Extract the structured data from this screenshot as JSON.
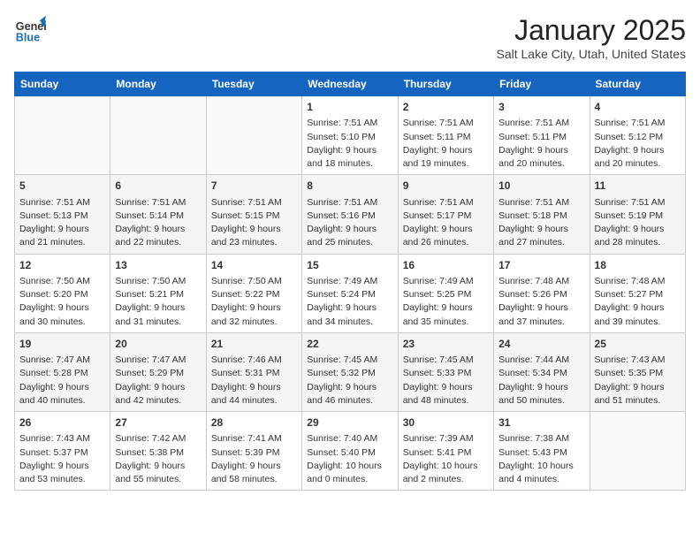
{
  "header": {
    "logo_line1": "General",
    "logo_line2": "Blue",
    "month": "January 2025",
    "location": "Salt Lake City, Utah, United States"
  },
  "days_of_week": [
    "Sunday",
    "Monday",
    "Tuesday",
    "Wednesday",
    "Thursday",
    "Friday",
    "Saturday"
  ],
  "weeks": [
    [
      {
        "day": "",
        "content": ""
      },
      {
        "day": "",
        "content": ""
      },
      {
        "day": "",
        "content": ""
      },
      {
        "day": "1",
        "content": "Sunrise: 7:51 AM\nSunset: 5:10 PM\nDaylight: 9 hours\nand 18 minutes."
      },
      {
        "day": "2",
        "content": "Sunrise: 7:51 AM\nSunset: 5:11 PM\nDaylight: 9 hours\nand 19 minutes."
      },
      {
        "day": "3",
        "content": "Sunrise: 7:51 AM\nSunset: 5:11 PM\nDaylight: 9 hours\nand 20 minutes."
      },
      {
        "day": "4",
        "content": "Sunrise: 7:51 AM\nSunset: 5:12 PM\nDaylight: 9 hours\nand 20 minutes."
      }
    ],
    [
      {
        "day": "5",
        "content": "Sunrise: 7:51 AM\nSunset: 5:13 PM\nDaylight: 9 hours\nand 21 minutes."
      },
      {
        "day": "6",
        "content": "Sunrise: 7:51 AM\nSunset: 5:14 PM\nDaylight: 9 hours\nand 22 minutes."
      },
      {
        "day": "7",
        "content": "Sunrise: 7:51 AM\nSunset: 5:15 PM\nDaylight: 9 hours\nand 23 minutes."
      },
      {
        "day": "8",
        "content": "Sunrise: 7:51 AM\nSunset: 5:16 PM\nDaylight: 9 hours\nand 25 minutes."
      },
      {
        "day": "9",
        "content": "Sunrise: 7:51 AM\nSunset: 5:17 PM\nDaylight: 9 hours\nand 26 minutes."
      },
      {
        "day": "10",
        "content": "Sunrise: 7:51 AM\nSunset: 5:18 PM\nDaylight: 9 hours\nand 27 minutes."
      },
      {
        "day": "11",
        "content": "Sunrise: 7:51 AM\nSunset: 5:19 PM\nDaylight: 9 hours\nand 28 minutes."
      }
    ],
    [
      {
        "day": "12",
        "content": "Sunrise: 7:50 AM\nSunset: 5:20 PM\nDaylight: 9 hours\nand 30 minutes."
      },
      {
        "day": "13",
        "content": "Sunrise: 7:50 AM\nSunset: 5:21 PM\nDaylight: 9 hours\nand 31 minutes."
      },
      {
        "day": "14",
        "content": "Sunrise: 7:50 AM\nSunset: 5:22 PM\nDaylight: 9 hours\nand 32 minutes."
      },
      {
        "day": "15",
        "content": "Sunrise: 7:49 AM\nSunset: 5:24 PM\nDaylight: 9 hours\nand 34 minutes."
      },
      {
        "day": "16",
        "content": "Sunrise: 7:49 AM\nSunset: 5:25 PM\nDaylight: 9 hours\nand 35 minutes."
      },
      {
        "day": "17",
        "content": "Sunrise: 7:48 AM\nSunset: 5:26 PM\nDaylight: 9 hours\nand 37 minutes."
      },
      {
        "day": "18",
        "content": "Sunrise: 7:48 AM\nSunset: 5:27 PM\nDaylight: 9 hours\nand 39 minutes."
      }
    ],
    [
      {
        "day": "19",
        "content": "Sunrise: 7:47 AM\nSunset: 5:28 PM\nDaylight: 9 hours\nand 40 minutes."
      },
      {
        "day": "20",
        "content": "Sunrise: 7:47 AM\nSunset: 5:29 PM\nDaylight: 9 hours\nand 42 minutes."
      },
      {
        "day": "21",
        "content": "Sunrise: 7:46 AM\nSunset: 5:31 PM\nDaylight: 9 hours\nand 44 minutes."
      },
      {
        "day": "22",
        "content": "Sunrise: 7:45 AM\nSunset: 5:32 PM\nDaylight: 9 hours\nand 46 minutes."
      },
      {
        "day": "23",
        "content": "Sunrise: 7:45 AM\nSunset: 5:33 PM\nDaylight: 9 hours\nand 48 minutes."
      },
      {
        "day": "24",
        "content": "Sunrise: 7:44 AM\nSunset: 5:34 PM\nDaylight: 9 hours\nand 50 minutes."
      },
      {
        "day": "25",
        "content": "Sunrise: 7:43 AM\nSunset: 5:35 PM\nDaylight: 9 hours\nand 51 minutes."
      }
    ],
    [
      {
        "day": "26",
        "content": "Sunrise: 7:43 AM\nSunset: 5:37 PM\nDaylight: 9 hours\nand 53 minutes."
      },
      {
        "day": "27",
        "content": "Sunrise: 7:42 AM\nSunset: 5:38 PM\nDaylight: 9 hours\nand 55 minutes."
      },
      {
        "day": "28",
        "content": "Sunrise: 7:41 AM\nSunset: 5:39 PM\nDaylight: 9 hours\nand 58 minutes."
      },
      {
        "day": "29",
        "content": "Sunrise: 7:40 AM\nSunset: 5:40 PM\nDaylight: 10 hours\nand 0 minutes."
      },
      {
        "day": "30",
        "content": "Sunrise: 7:39 AM\nSunset: 5:41 PM\nDaylight: 10 hours\nand 2 minutes."
      },
      {
        "day": "31",
        "content": "Sunrise: 7:38 AM\nSunset: 5:43 PM\nDaylight: 10 hours\nand 4 minutes."
      },
      {
        "day": "",
        "content": ""
      }
    ]
  ]
}
